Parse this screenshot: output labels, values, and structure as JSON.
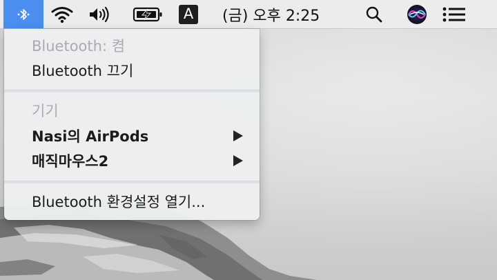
{
  "menubar": {
    "bluetooth_icon": "bluetooth-icon",
    "wifi_icon": "wifi-icon",
    "volume_icon": "volume-icon",
    "battery_icon": "battery-charging-icon",
    "input_source_label": "A",
    "clock": "(금) 오후 2:25",
    "search_icon": "spotlight-search-icon",
    "siri_icon": "siri-icon",
    "notification_icon": "notification-center-icon",
    "accent_color": "#4a8ff0"
  },
  "bluetooth_menu": {
    "status_label": "Bluetooth: 켬",
    "toggle_label": "Bluetooth 끄기",
    "devices_header": "기기",
    "devices": [
      {
        "name": "Nasi의 AirPods",
        "submenu_icon": "submenu-arrow-icon"
      },
      {
        "name": "매직마우스2",
        "submenu_icon": "submenu-arrow-icon"
      }
    ],
    "open_prefs_label": "Bluetooth 환경설정 열기..."
  }
}
